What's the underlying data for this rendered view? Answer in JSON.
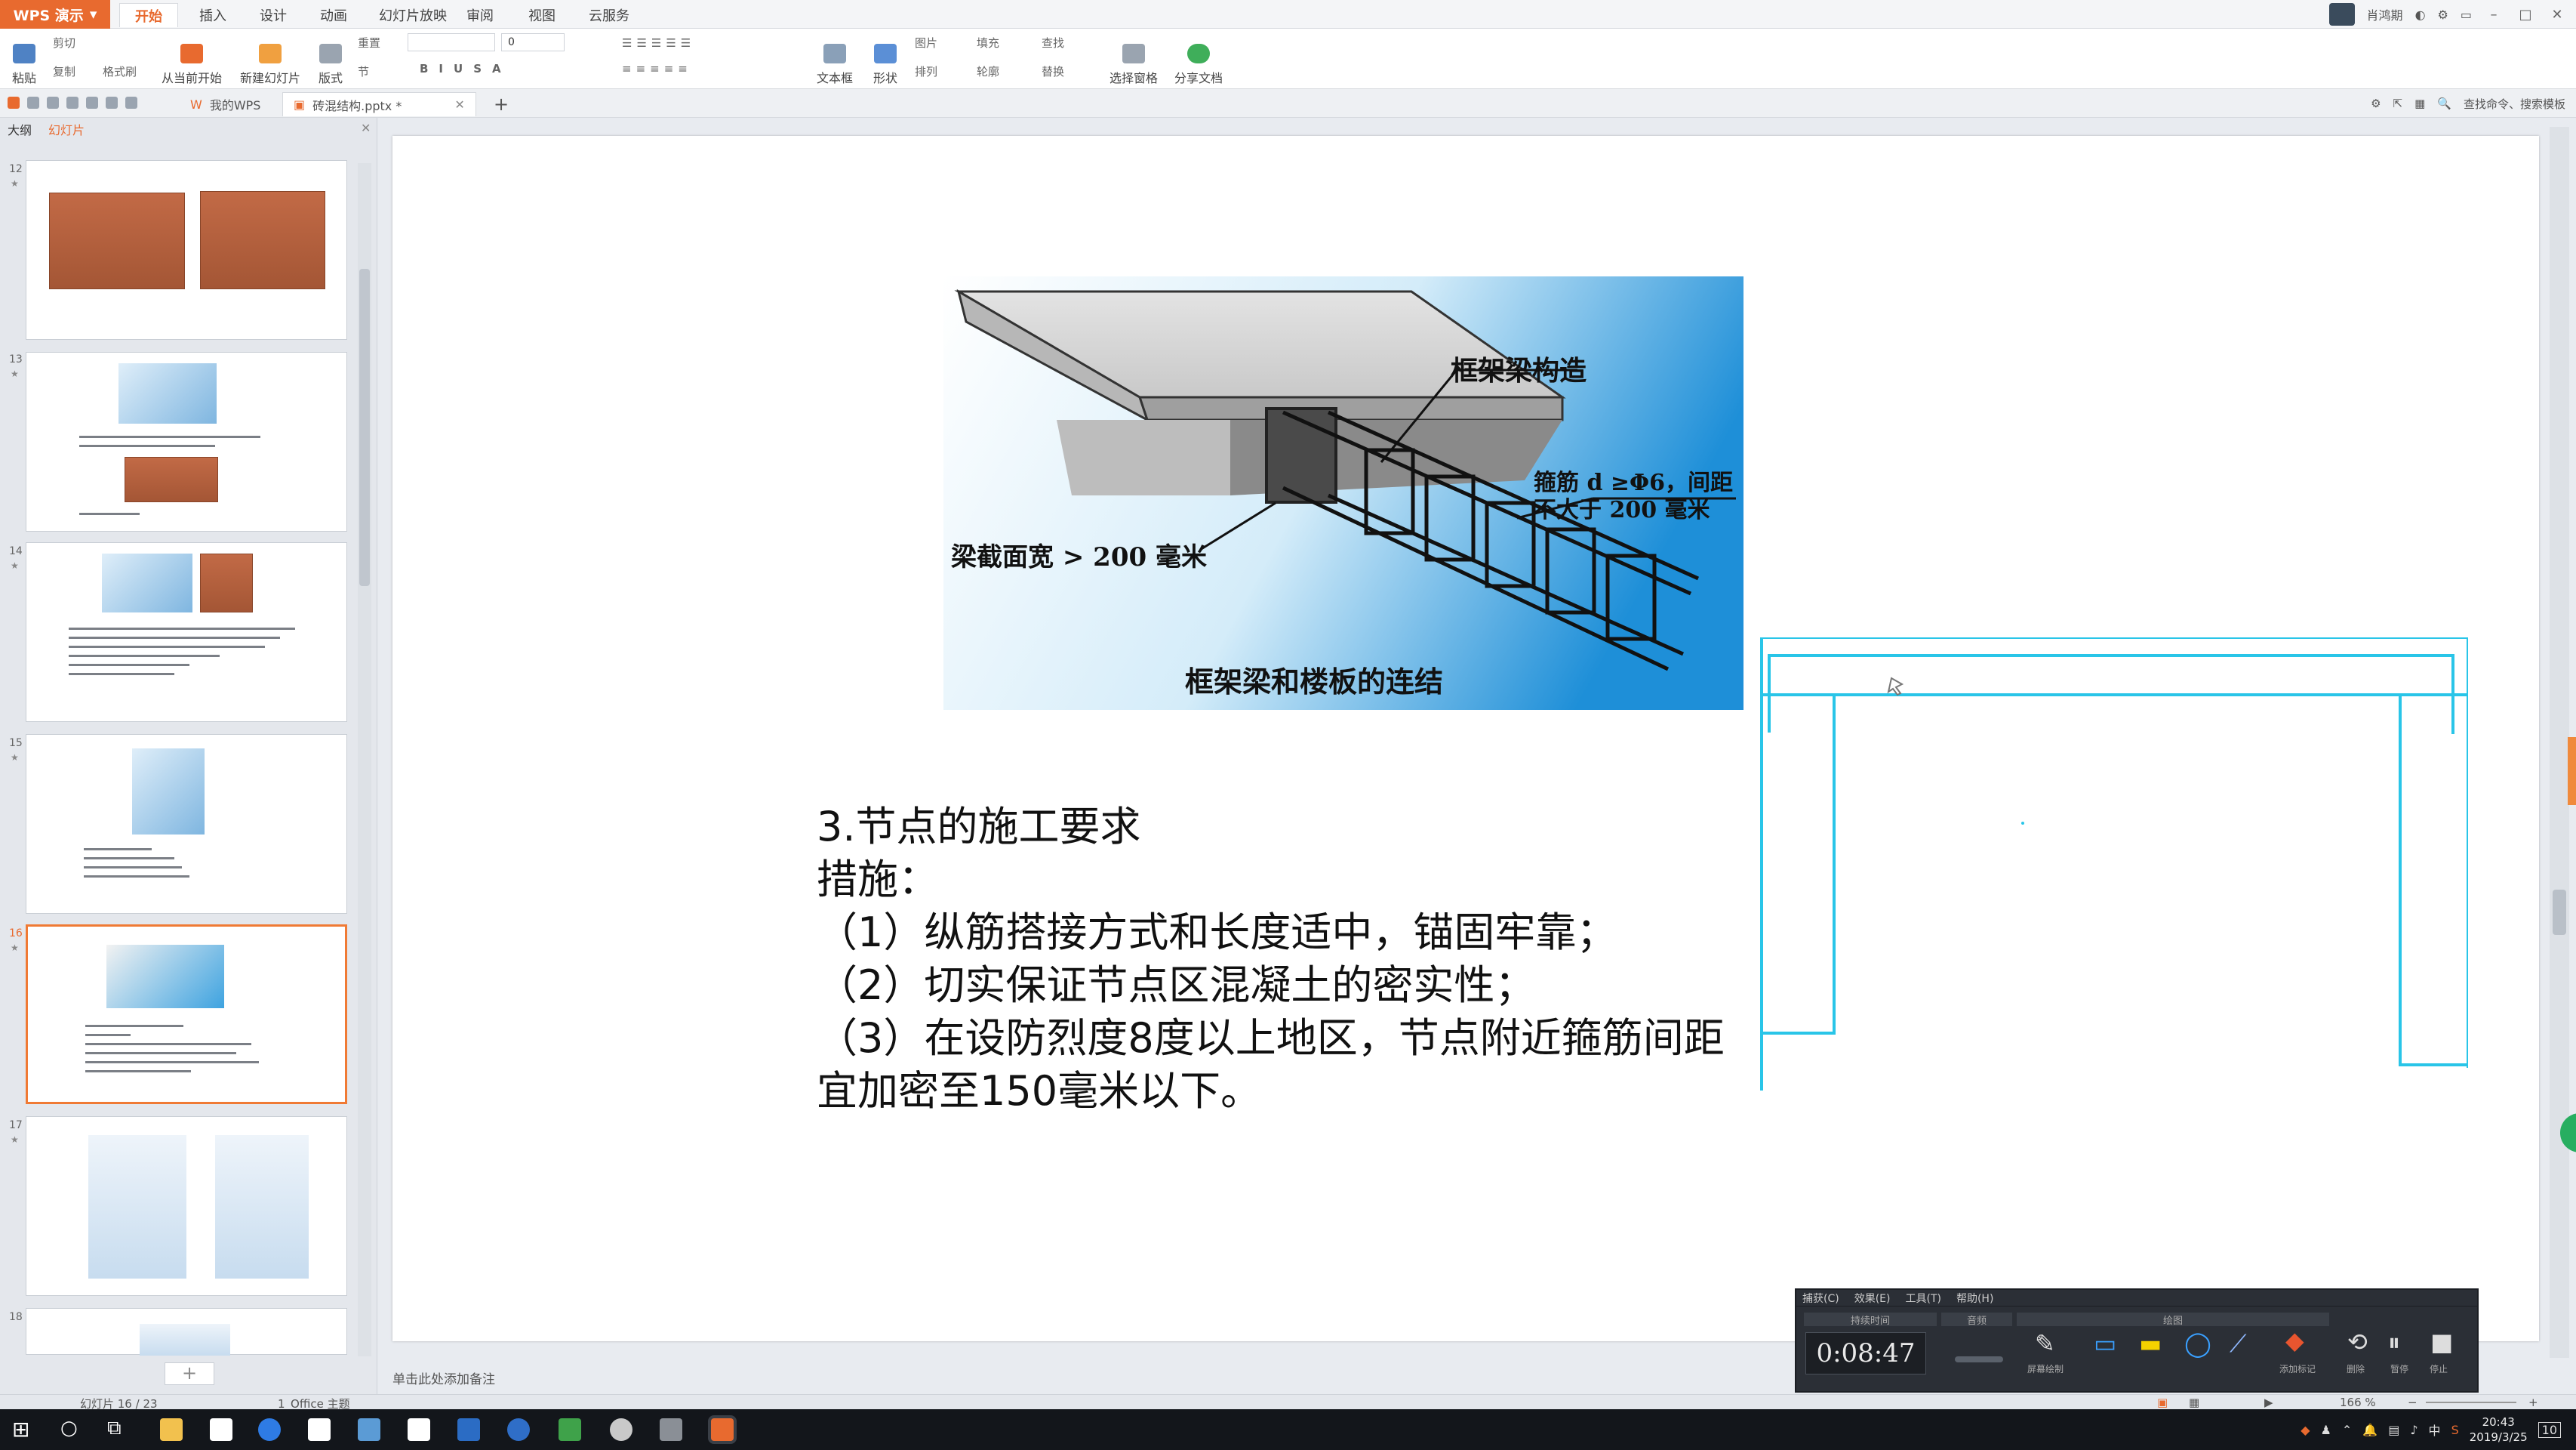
{
  "app": {
    "name": "WPS 演示",
    "ribbon_tabs": [
      "开始",
      "插入",
      "设计",
      "动画",
      "幻灯片放映",
      "审阅",
      "视图",
      "云服务"
    ],
    "active_tab": "开始",
    "user_name": "肖鸿期"
  },
  "ribbon": {
    "paste": "粘贴",
    "cut": "剪切",
    "copy": "复制",
    "format_painter": "格式刷",
    "play_from_current": "从当前开始",
    "new_slide": "新建幻灯片",
    "layout": "版式",
    "section": "节",
    "reset": "重置",
    "font_size": "0",
    "textbox": "文本框",
    "shape": "形状",
    "picture": "图片",
    "fill": "填充",
    "arrange": "排列",
    "outline": "轮廓",
    "find": "查找",
    "replace": "替换",
    "select_pane": "选择窗格",
    "share": "分享文档"
  },
  "doc_tabs": [
    {
      "label": "我的WPS"
    },
    {
      "label": "砖混结构.pptx *"
    }
  ],
  "right_tools": {
    "search_cmd": "查找命令、搜索模板"
  },
  "panel": {
    "tab_outline": "大纲",
    "tab_slides": "幻灯片",
    "slide_numbers": [
      "12",
      "13",
      "14",
      "15",
      "16",
      "17",
      "18"
    ]
  },
  "slide": {
    "figure_labels": {
      "beam_structure": "框架梁构造",
      "stirrup": "箍筋 d ≥Φ6，间距",
      "stirrup_line2": "不大于 200 毫米",
      "beam_width": "梁截面宽 > 200 毫米",
      "caption": "框架梁和楼板的连结"
    },
    "heading": "3.节点的施工要求",
    "measures": "措施：",
    "items": [
      "（1）纵筋搭接方式和长度适中，锚固牢靠；",
      "（2）切实保证节点区混凝土的密实性；",
      "（3）在设防烈度8度以上地区，节点附近箍筋间距",
      "宜加密至150毫米以下。"
    ]
  },
  "notes_hint": "单击此处添加备注",
  "recorder": {
    "menu": [
      "捕获(C)",
      "效果(E)",
      "工具(T)",
      "帮助(H)"
    ],
    "heading_time": "持续时间",
    "heading_audio": "音频",
    "heading_draw": "绘图",
    "time": "0:08:47",
    "annotate": "屏幕绘制",
    "add_mark": "添加标记",
    "delete": "删除",
    "pause": "暂停",
    "stop": "停止"
  },
  "statusbar": {
    "slide_count": "幻灯片 16 / 23",
    "theme": "1_Office 主题",
    "zoom": "166 %"
  },
  "taskbar": {
    "time": "20:43",
    "date": "2019/3/25",
    "ime": "中",
    "notify_count": "10"
  }
}
